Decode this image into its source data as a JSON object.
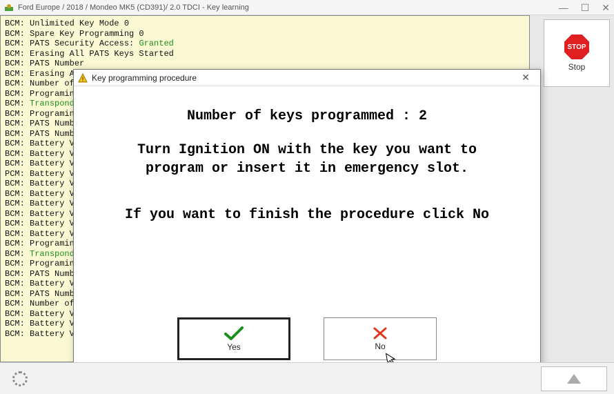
{
  "window": {
    "title": "Ford Europe / 2018 / Mondeo MK5 (CD391)/ 2.0 TDCI - Key learning"
  },
  "log": [
    {
      "prefix": "BCM: ",
      "text": "Unlimited Key Mode 0"
    },
    {
      "prefix": "BCM: ",
      "text": "Spare Key Programming 0"
    },
    {
      "prefix": "BCM: ",
      "text": "PATS Security Access: ",
      "status": "Granted"
    },
    {
      "prefix": "BCM: ",
      "text": "Erasing All PATS Keys Started"
    },
    {
      "prefix": "BCM: ",
      "text": "PATS Number"
    },
    {
      "prefix": "BCM: ",
      "text": "Erasing All"
    },
    {
      "prefix": "BCM: ",
      "text": "Number of K"
    },
    {
      "prefix": "BCM: ",
      "text": "Programing"
    },
    {
      "prefix": "BCM: ",
      "text": "",
      "status": "Transponder"
    },
    {
      "prefix": "BCM: ",
      "text": "Programing"
    },
    {
      "prefix": "BCM: ",
      "text": "PATS Number"
    },
    {
      "prefix": "BCM: ",
      "text": "PATS Number"
    },
    {
      "prefix": "BCM: ",
      "text": "Battery Vol"
    },
    {
      "prefix": "BCM: ",
      "text": "Battery Vol"
    },
    {
      "prefix": "BCM: ",
      "text": "Battery Vol"
    },
    {
      "prefix": "PCM: ",
      "text": "Battery Vol"
    },
    {
      "prefix": "BCM: ",
      "text": "Battery Vol"
    },
    {
      "prefix": "BCM: ",
      "text": "Battery Vol"
    },
    {
      "prefix": "BCM: ",
      "text": "Battery Vol"
    },
    {
      "prefix": "BCM: ",
      "text": "Battery Vol"
    },
    {
      "prefix": "BCM: ",
      "text": "Battery Vol"
    },
    {
      "prefix": "BCM: ",
      "text": "Battery Vol"
    },
    {
      "prefix": "BCM: ",
      "text": "Programing"
    },
    {
      "prefix": "BCM: ",
      "text": "",
      "status": "Transponder"
    },
    {
      "prefix": "BCM: ",
      "text": "Programing"
    },
    {
      "prefix": "BCM: ",
      "text": "PATS Number"
    },
    {
      "prefix": "BCM: ",
      "text": "Battery Vol"
    },
    {
      "prefix": "BCM: ",
      "text": "PATS Number"
    },
    {
      "prefix": "BCM: ",
      "text": "Number of K"
    },
    {
      "prefix": "BCM: ",
      "text": "Battery Vol"
    },
    {
      "prefix": "BCM: ",
      "text": "Battery Vol"
    },
    {
      "prefix": "BCM: ",
      "text": "Battery Vol"
    }
  ],
  "side": {
    "stop_label": "Stop",
    "stop_text": "STOP"
  },
  "dialog": {
    "title": "Key programming procedure",
    "line1": "Number of keys programmed : 2",
    "line2a": "Turn Ignition ON with the key you want to",
    "line2b": "program or insert it in emergency slot.",
    "line3": "If you want to finish the procedure click No",
    "yes_label": "Yes",
    "no_label": "No"
  }
}
